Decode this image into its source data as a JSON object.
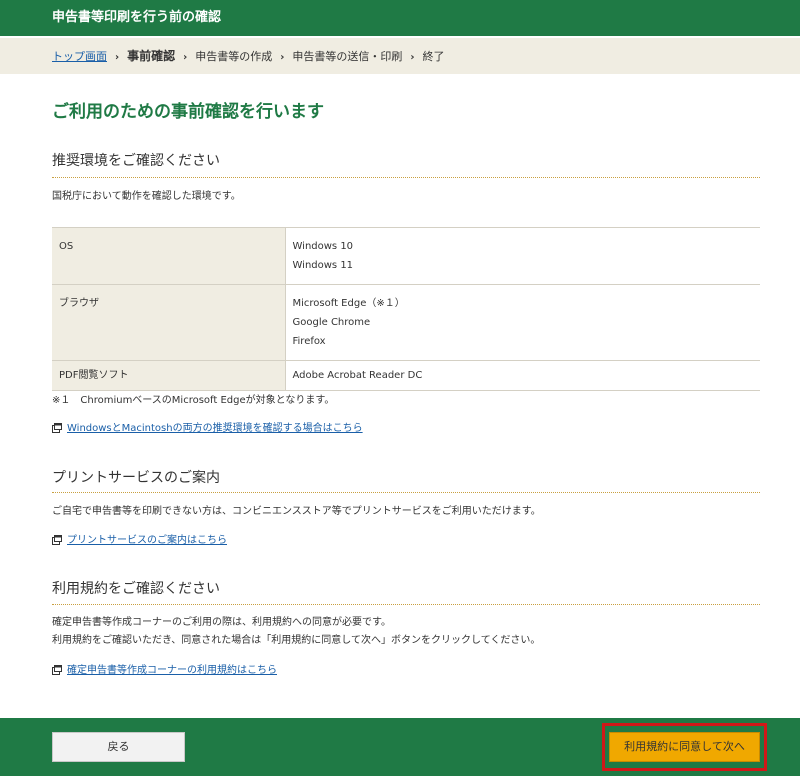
{
  "header": {
    "title": "申告書等印刷を行う前の確認"
  },
  "breadcrumb": {
    "top": "トップ画面",
    "current": "事前確認",
    "step3": "申告書等の作成",
    "step4": "申告書等の送信・印刷",
    "step5": "終了",
    "separator": "›"
  },
  "main": {
    "title": "ご利用のための事前確認を行います",
    "env": {
      "heading": "推奨環境をご確認ください",
      "intro": "国税庁において動作を確認した環境です。",
      "rows": [
        {
          "key": "OS",
          "values": [
            "Windows 10",
            "Windows 11"
          ]
        },
        {
          "key": "ブラウザ",
          "values": [
            "Microsoft Edge（※１）",
            "Google Chrome",
            "Firefox"
          ]
        },
        {
          "key": "PDF閲覧ソフト",
          "values": [
            "Adobe Acrobat Reader DC"
          ]
        }
      ],
      "note": "※１　ChromiumベースのMicrosoft Edgeが対象となります。",
      "link": "WindowsとMacintoshの両方の推奨環境を確認する場合はこちら"
    },
    "print": {
      "heading": "プリントサービスのご案内",
      "text": "ご自宅で申告書等を印刷できない方は、コンビニエンスストア等でプリントサービスをご利用いただけます。",
      "link": "プリントサービスのご案内はこちら"
    },
    "terms": {
      "heading": "利用規約をご確認ください",
      "text1": "確定申告書等作成コーナーのご利用の際は、利用規約への同意が必要です。",
      "text2": "利用規約をご確認いただき、同意された場合は「利用規約に同意して次へ」ボタンをクリックしてください。",
      "link": "確定申告書等作成コーナーの利用規約はこちら"
    }
  },
  "footer": {
    "back_label": "戻る",
    "next_label": "利用規約に同意して次へ"
  },
  "colors": {
    "brand_green": "#1f7a45",
    "breadcrumb_bg": "#f0ede2",
    "link_blue": "#1a5fa8",
    "accent_orange": "#f0a800",
    "highlight_red": "#d01818"
  },
  "icons": {
    "external_link": "new-window-icon"
  }
}
